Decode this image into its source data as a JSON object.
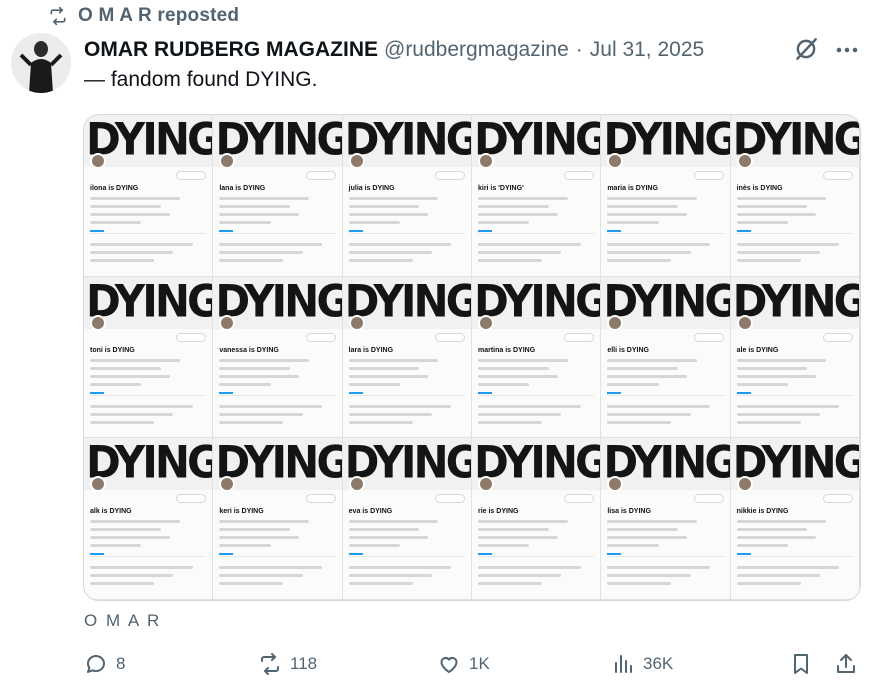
{
  "repost": {
    "label": "O M A R reposted",
    "icon": "repost-icon"
  },
  "post": {
    "author_name": "OMAR RUDBERG MAGAZINE",
    "handle": "@rudbergmagazine",
    "separator": "·",
    "date": "Jul 31, 2025",
    "text": "— fandom found DYING.",
    "grok_icon": "grok-icon",
    "more_icon": "more-icon"
  },
  "media": {
    "banner_word": "DYING",
    "tiles": [
      {
        "name": "ilona is DYING"
      },
      {
        "name": "lana is DYING"
      },
      {
        "name": "julia is DYING"
      },
      {
        "name": "kiri is 'DYING'"
      },
      {
        "name": "maria is DYING"
      },
      {
        "name": "inès is DYING"
      },
      {
        "name": "toni is DYING"
      },
      {
        "name": "vanessa is DYING"
      },
      {
        "name": "lara is DYING"
      },
      {
        "name": "martina is DYING"
      },
      {
        "name": "elli is DYING"
      },
      {
        "name": "ale is DYING"
      },
      {
        "name": "alk is DYING"
      },
      {
        "name": "keri is DYING"
      },
      {
        "name": "eva is DYING"
      },
      {
        "name": "rie is DYING"
      },
      {
        "name": "lisa is DYING"
      },
      {
        "name": "nikkie is DYING"
      }
    ]
  },
  "credit": "O M A R",
  "actions": {
    "reply": {
      "count": "8",
      "icon": "reply-icon"
    },
    "repost": {
      "count": "118",
      "icon": "repost-icon"
    },
    "like": {
      "count": "1K",
      "icon": "heart-icon"
    },
    "views": {
      "count": "36K",
      "icon": "views-icon"
    },
    "bookmark": {
      "icon": "bookmark-icon"
    },
    "share": {
      "icon": "share-icon"
    }
  }
}
